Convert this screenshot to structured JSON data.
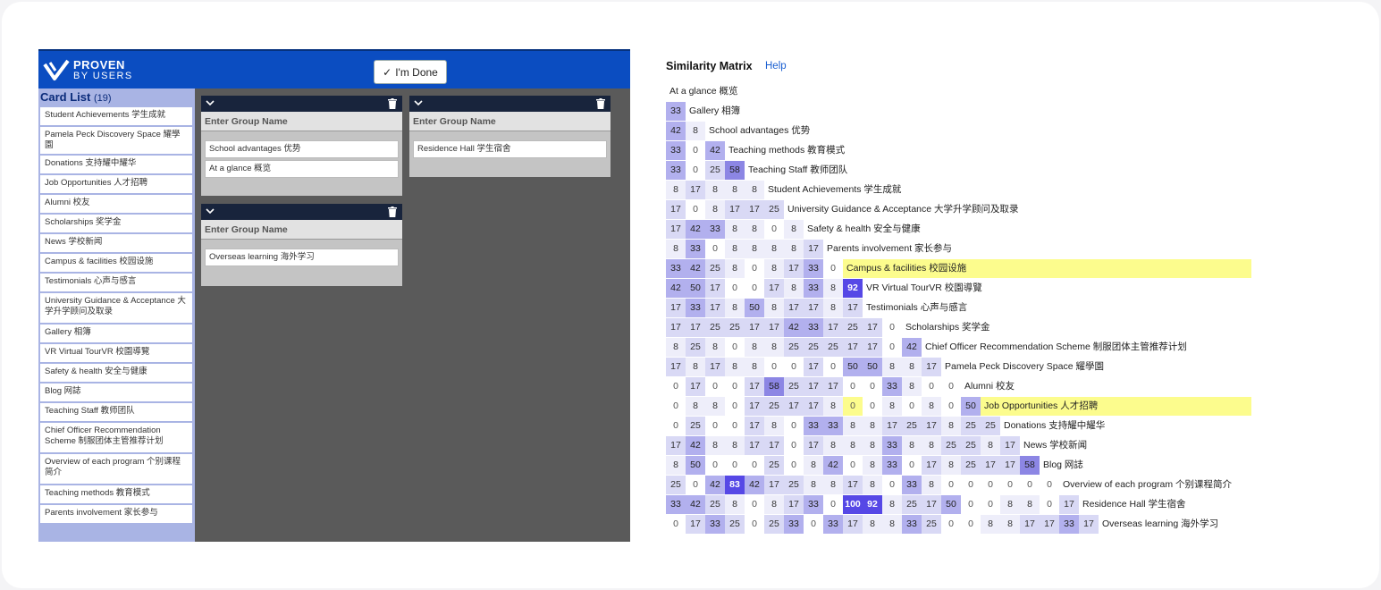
{
  "logo": {
    "line1": "PROVEN",
    "line2": "BY USERS"
  },
  "done_button": "I'm Done",
  "sidebar": {
    "title": "Card List",
    "count": "(19)",
    "cards": [
      "Student Achievements 学生成就",
      "Pamela Peck Discovery Space 耀學園",
      "Donations 支持耀中耀华",
      "Job Opportunities 人才招聘",
      "Alumni 校友",
      "Scholarships 奖学金",
      "News 学校新闻",
      "Campus & facilities 校园设施",
      "Testimonials 心声与感言",
      "University Guidance & Acceptance 大学升学顾问及取录",
      "Gallery 相簿",
      "VR Virtual TourVR 校園導覽",
      "Safety & health 安全与健康",
      "Blog 网誌",
      "Teaching Staff 教师团队",
      "Chief Officer Recommendation Scheme 制服团体主管推荐计划",
      "Overview of each program 个别课程简介",
      "Teaching methods 教育模式",
      "Parents involvement 家长参与"
    ]
  },
  "groups": [
    {
      "name_placeholder": "Enter Group Name",
      "cards": [
        "School advantages 优势",
        "At a glance 概览"
      ]
    },
    {
      "name_placeholder": "Enter Group Name",
      "cards": [
        "Residence Hall 学生宿舍"
      ]
    },
    {
      "name_placeholder": "Enter Group Name",
      "cards": [
        "Overseas learning 海外学习"
      ]
    }
  ],
  "matrix": {
    "title": "Similarity Matrix",
    "help": "Help",
    "colors": {
      "low": "#d9d9f5",
      "mid": "#b2b0ee",
      "high": "#8c86e4",
      "top": "#6a5fdc",
      "max": "#5648e6",
      "highlight": "#fcfc8d"
    },
    "rows": [
      {
        "label": "At a glance 概览",
        "values": []
      },
      {
        "label": "Gallery 相簿",
        "values": [
          33
        ]
      },
      {
        "label": "School advantages 优势",
        "values": [
          42,
          8
        ]
      },
      {
        "label": "Teaching methods 教育模式",
        "values": [
          33,
          0,
          42
        ]
      },
      {
        "label": "Teaching Staff 教师团队",
        "values": [
          33,
          0,
          25,
          58
        ]
      },
      {
        "label": "Student Achievements 学生成就",
        "values": [
          8,
          17,
          8,
          8,
          8
        ]
      },
      {
        "label": "University Guidance & Acceptance 大学升学顾问及取录",
        "values": [
          17,
          0,
          8,
          17,
          17,
          25
        ]
      },
      {
        "label": "Safety & health 安全与健康",
        "values": [
          17,
          42,
          33,
          8,
          8,
          0,
          8
        ]
      },
      {
        "label": "Parents involvement 家长参与",
        "values": [
          8,
          33,
          0,
          8,
          8,
          8,
          8,
          17
        ]
      },
      {
        "label": "Campus & facilities 校园设施",
        "values": [
          33,
          42,
          25,
          8,
          0,
          8,
          17,
          33,
          0
        ],
        "highlight": true
      },
      {
        "label": "VR Virtual TourVR 校園導覽",
        "values": [
          42,
          50,
          17,
          0,
          0,
          17,
          8,
          33,
          8,
          92
        ]
      },
      {
        "label": "Testimonials 心声与感言",
        "values": [
          17,
          33,
          17,
          8,
          50,
          8,
          17,
          17,
          8,
          17
        ]
      },
      {
        "label": "Scholarships 奖学金",
        "values": [
          17,
          17,
          25,
          25,
          17,
          17,
          42,
          33,
          17,
          25,
          17,
          0
        ]
      },
      {
        "label": "Chief Officer Recommendation Scheme 制服团体主管推荐计划",
        "values": [
          8,
          25,
          8,
          0,
          8,
          8,
          25,
          25,
          25,
          17,
          17,
          0,
          42
        ]
      },
      {
        "label": "Pamela Peck Discovery Space 耀學園",
        "values": [
          17,
          8,
          17,
          8,
          8,
          0,
          0,
          17,
          0,
          50,
          50,
          8,
          8,
          17
        ]
      },
      {
        "label": "Alumni 校友",
        "values": [
          0,
          17,
          0,
          0,
          17,
          58,
          25,
          17,
          17,
          0,
          0,
          33,
          8,
          0,
          0
        ]
      },
      {
        "label": "Job Opportunities 人才招聘",
        "values": [
          0,
          8,
          8,
          0,
          17,
          25,
          17,
          17,
          8,
          0,
          0,
          8,
          0,
          8,
          0,
          50
        ],
        "highlight": true,
        "hl_cell": 9
      },
      {
        "label": "Donations 支持耀中耀华",
        "values": [
          0,
          25,
          0,
          0,
          17,
          8,
          0,
          33,
          33,
          8,
          8,
          17,
          25,
          17,
          8,
          25,
          25
        ]
      },
      {
        "label": "News 学校新闻",
        "values": [
          17,
          42,
          8,
          8,
          17,
          17,
          0,
          17,
          8,
          8,
          8,
          33,
          8,
          8,
          25,
          25,
          8,
          17
        ]
      },
      {
        "label": "Blog 网誌",
        "values": [
          8,
          50,
          0,
          0,
          0,
          25,
          0,
          8,
          42,
          0,
          8,
          33,
          0,
          17,
          8,
          25,
          17,
          17,
          58
        ]
      },
      {
        "label": "Overview of each program 个别课程简介",
        "values": [
          25,
          0,
          42,
          83,
          42,
          17,
          25,
          8,
          8,
          17,
          8,
          0,
          33,
          8,
          0,
          0,
          0,
          0,
          0,
          0
        ]
      },
      {
        "label": "Residence Hall 学生宿舍",
        "values": [
          33,
          42,
          25,
          8,
          0,
          8,
          17,
          33,
          0,
          100,
          92,
          8,
          25,
          17,
          50,
          0,
          0,
          8,
          8,
          0,
          17
        ]
      },
      {
        "label": "Overseas learning 海外学习",
        "values": [
          0,
          17,
          33,
          25,
          0,
          25,
          33,
          0,
          33,
          17,
          8,
          8,
          33,
          25,
          0,
          0,
          8,
          8,
          17,
          17,
          33,
          17
        ]
      }
    ]
  }
}
